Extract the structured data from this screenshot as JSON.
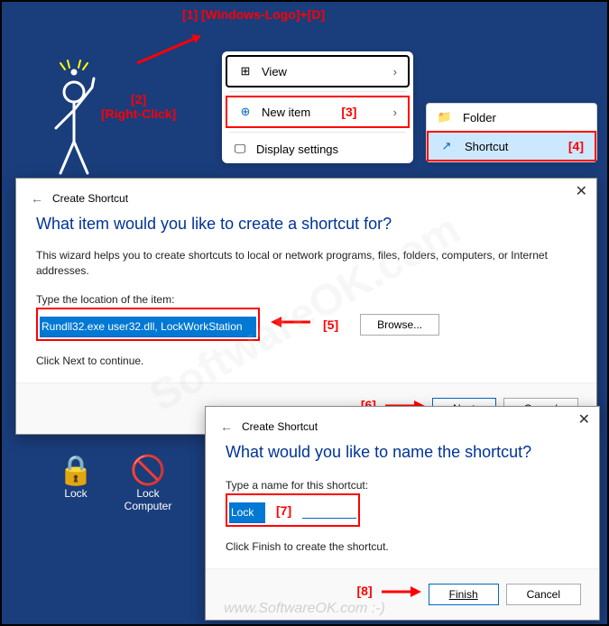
{
  "annotations": {
    "a1": "[1]  [Windows-Logo]+[D]",
    "a2": "[2]\n[Right-Click]",
    "a3": "[3]",
    "a4": "[4]",
    "a5": "[5]",
    "a6": "[6]",
    "a7": "[7]",
    "a8": "[8]"
  },
  "context_menu": {
    "view": "View",
    "new_item": "New item",
    "display": "Display settings"
  },
  "submenu": {
    "folder": "Folder",
    "shortcut": "Shortcut"
  },
  "wizard1": {
    "header": "Create Shortcut",
    "title": "What item would you like to create a shortcut for?",
    "desc": "This wizard helps you to create shortcuts to local or network programs, files, folders, computers, or Internet addresses.",
    "loc_label": "Type the location of the item:",
    "loc_value": "Rundll32.exe user32.dll, LockWorkStation",
    "browse": "Browse...",
    "hint": "Click Next to continue.",
    "next": "Next",
    "cancel": "Cancel"
  },
  "wizard2": {
    "header": "Create Shortcut",
    "title": "What would you like to name the shortcut?",
    "name_label": "Type a name for this shortcut:",
    "name_value": "Lock",
    "hint": "Click Finish to create the shortcut.",
    "finish": "Finish",
    "cancel": "Cancel"
  },
  "desktop": {
    "lock": "Lock",
    "lock_computer": "Lock\nComputer"
  },
  "watermark": "SoftwareOK.com",
  "footer": "www.SoftwareOK.com :-)"
}
